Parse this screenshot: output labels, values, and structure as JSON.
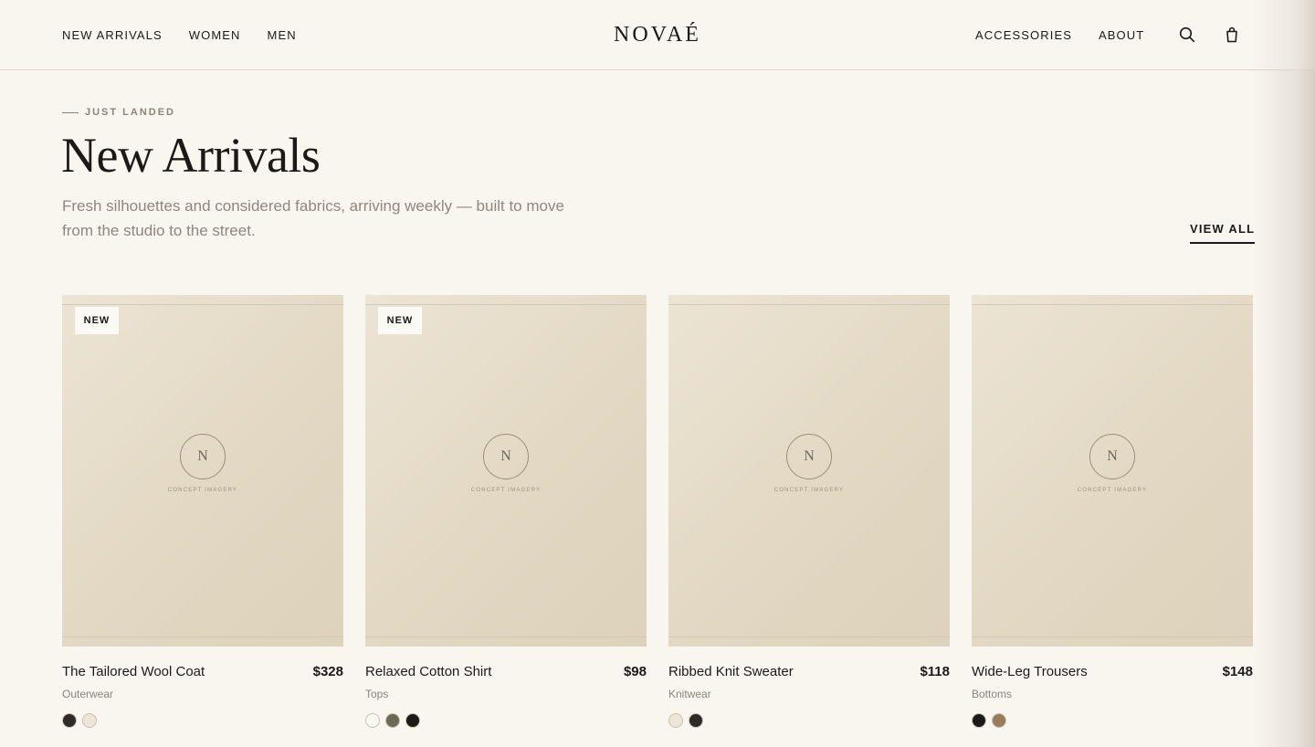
{
  "header": {
    "nav_left": [
      "NEW ARRIVALS",
      "WOMEN",
      "MEN"
    ],
    "logo": "NOVAÉ",
    "nav_right": [
      "ACCESSORIES",
      "ABOUT"
    ],
    "icons": [
      "search-icon",
      "shopping-bag-icon"
    ]
  },
  "intro": {
    "eyebrow": "JUST LANDED",
    "title": "New Arrivals",
    "subtitle": "Fresh silhouettes and considered fabrics, arriving weekly — built to move from the studio to the street.",
    "view_all": "VIEW ALL"
  },
  "products": [
    {
      "badge": "NEW",
      "monogram": "N",
      "image_caption": "CONCEPT IMAGERY",
      "name": "The Tailored Wool Coat",
      "price": "$328",
      "category": "Outerwear",
      "swatches": [
        "#2e2b26",
        "#ece6d8"
      ]
    },
    {
      "badge": "NEW",
      "monogram": "N",
      "image_caption": "CONCEPT IMAGERY",
      "name": "Relaxed Cotton Shirt",
      "price": "$98",
      "category": "Tops",
      "swatches": [
        "#faf8f2",
        "#6c6a55",
        "#1c1a16"
      ]
    },
    {
      "badge": "",
      "monogram": "N",
      "image_caption": "CONCEPT IMAGERY",
      "name": "Ribbed Knit Sweater",
      "price": "$118",
      "category": "Knitwear",
      "swatches": [
        "#ece6d8",
        "#2e2b26"
      ]
    },
    {
      "badge": "",
      "monogram": "N",
      "image_caption": "CONCEPT IMAGERY",
      "name": "Wide-Leg Trousers",
      "price": "$148",
      "category": "Bottoms",
      "swatches": [
        "#1c1a16",
        "#9a7b5a"
      ]
    }
  ],
  "colors": {
    "background": "#f9f6ef",
    "text": "#1c1a16",
    "muted": "#8a8479",
    "card": "#e6ddca"
  }
}
